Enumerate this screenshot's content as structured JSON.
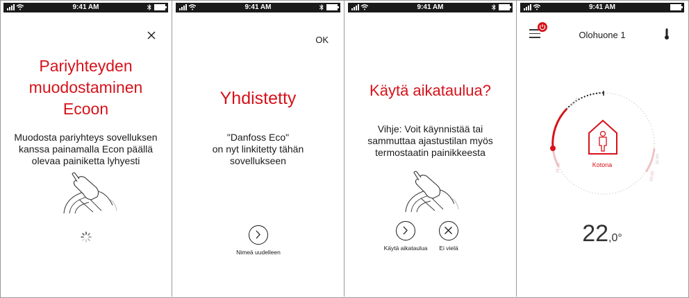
{
  "status_bar": {
    "time": "9:41 AM"
  },
  "screen1": {
    "title_lines": [
      "Pariyhteyden",
      "muodostaminen",
      "Ecoon"
    ],
    "body_lines": [
      "Muodosta pariyhteys sovelluksen",
      "kanssa painamalla Econ päällä",
      "olevaa painiketta lyhyesti"
    ]
  },
  "screen2": {
    "ok_label": "OK",
    "title": "Yhdistetty",
    "body_lines": [
      "\"Danfoss Eco\"",
      "on nyt linkitetty tähän",
      "sovellukseen"
    ],
    "rename_label": "Nimeä uudelleen"
  },
  "screen3": {
    "title": "Käytä aikataulua?",
    "body_lines": [
      "Vihje: Voit käynnistää tai",
      "sammuttaa ajastustilan myös",
      "termostaatin painikkeesta"
    ],
    "use_label": "Käytä aikataulua",
    "notyet_label": "Ei vielä"
  },
  "screen4": {
    "room_name": "Olohuone 1",
    "mode_label": "Kotona",
    "dial_ticks": [
      "16:00",
      "00:00",
      "06:30",
      "15:15"
    ],
    "temperature_int": "22",
    "temperature_dec": ",0°"
  },
  "colors": {
    "accent": "#d6121a",
    "text": "#1a1a1a"
  }
}
